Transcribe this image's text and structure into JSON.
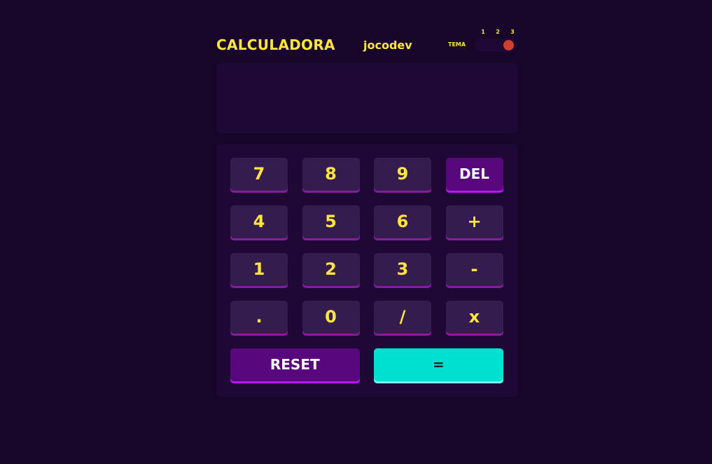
{
  "header": {
    "title": "CALCULADORA",
    "brand": "jocodev",
    "theme_label": "TEMA",
    "theme_options": [
      "1",
      "2",
      "3"
    ],
    "active_theme": 3
  },
  "display": {
    "value": ""
  },
  "keys": {
    "row1": [
      "7",
      "8",
      "9",
      "DEL"
    ],
    "row2": [
      "4",
      "5",
      "6",
      "+"
    ],
    "row3": [
      "1",
      "2",
      "3",
      "-"
    ],
    "row4": [
      ".",
      "0",
      "/",
      "x"
    ],
    "reset": "RESET",
    "equals": "="
  },
  "colors": {
    "background": "#17062a",
    "panel": "#1e0836",
    "key": "#341c4f",
    "key_shadow": "#881c9e",
    "key_text": "#ffe53d",
    "accent_key": "#58077d",
    "accent_shadow": "#bc15f4",
    "equals_key": "#00e0d1",
    "toggle_knob": "#d03f2f"
  }
}
